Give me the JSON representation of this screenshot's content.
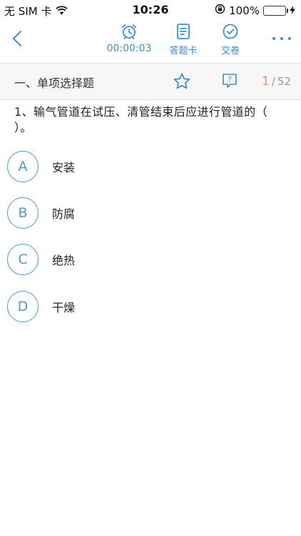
{
  "status_bar": {
    "carrier": "无 SIM 卡",
    "time": "10:26",
    "battery": "100%"
  },
  "toolbar": {
    "timer": "00:00:03",
    "answer_card_label": "答题卡",
    "submit_label": "交卷"
  },
  "section": {
    "title": "一、单项选择题",
    "current": "1",
    "separator": "/",
    "total": "52"
  },
  "question": {
    "text": "1、输气管道在试压、清管结束后应进行管道的（ ）。"
  },
  "options": [
    {
      "letter": "A",
      "text": "安装"
    },
    {
      "letter": "B",
      "text": "防腐"
    },
    {
      "letter": "C",
      "text": "绝热"
    },
    {
      "letter": "D",
      "text": "干燥"
    }
  ],
  "colors": {
    "accent": "#3a8fd6",
    "counter_current": "#f08a6c",
    "battery": "#4cd964"
  }
}
